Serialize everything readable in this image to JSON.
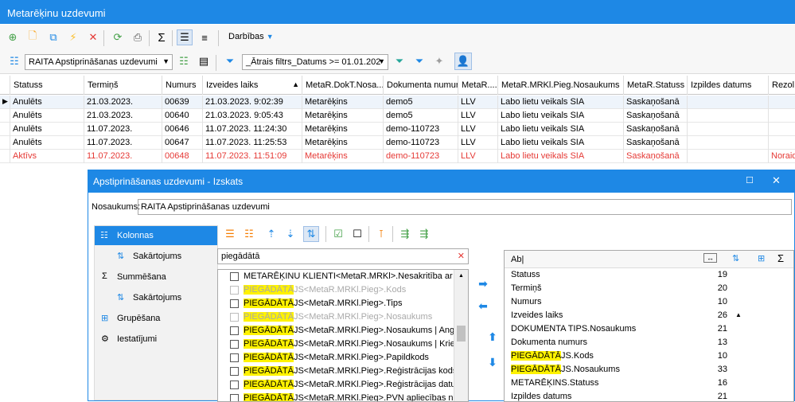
{
  "window": {
    "title": "Metarēķinu uzdevumi"
  },
  "toolbar": {
    "actions_label": "Darbības"
  },
  "views": {
    "selected": "RAITA Apstiprināšanas uzdevumi"
  },
  "filter": {
    "value": "_Ātrais filtrs_Datums >= 01.01.202"
  },
  "grid": {
    "columns": [
      "Statuss",
      "Termiņš",
      "Numurs",
      "Izveides laiks",
      "MetaR.DokT.Nosa...",
      "Dokumenta numurs",
      "MetaR....",
      "MetaR.MRKl.Pieg.Nosaukums",
      "MetaR.Statuss",
      "Izpildes datums",
      "Rezol..."
    ],
    "rows": [
      [
        "Anulēts",
        "21.03.2023.",
        "00639",
        "21.03.2023. 9:02:39",
        "Metarēķins",
        "demo5",
        "LLV",
        "Labo lietu veikals SIA",
        "Saskaņošanā",
        "",
        ""
      ],
      [
        "Anulēts",
        "21.03.2023.",
        "00640",
        "21.03.2023. 9:05:43",
        "Metarēķins",
        "demo5",
        "LLV",
        "Labo lietu veikals SIA",
        "Saskaņošanā",
        "",
        ""
      ],
      [
        "Anulēts",
        "11.07.2023.",
        "00646",
        "11.07.2023. 11:24:30",
        "Metarēķins",
        "demo-110723",
        "LLV",
        "Labo lietu veikals SIA",
        "Saskaņošanā",
        "",
        ""
      ],
      [
        "Anulēts",
        "11.07.2023.",
        "00647",
        "11.07.2023. 11:25:53",
        "Metarēķins",
        "demo-110723",
        "LLV",
        "Labo lietu veikals SIA",
        "Saskaņošanā",
        "",
        ""
      ],
      [
        "Aktīvs",
        "11.07.2023.",
        "00648",
        "11.07.2023. 11:51:09",
        "Metarēķins",
        "demo-110723",
        "LLV",
        "Labo lietu veikals SIA",
        "Saskaņošanā",
        "",
        "Noraid"
      ]
    ]
  },
  "dialog": {
    "title": "Apstiprināšanas uzdevumi - Izskats",
    "name_label": "Nosaukums:",
    "name_value": "RAITA Apstiprināšanas uzdevumi",
    "sidebar": [
      "Kolonnas",
      "Sakārtojums",
      "Summēšana",
      "Sakārtojums",
      "Grupēšana",
      "Iestatījumi"
    ],
    "search_value": "piegādātā",
    "available": [
      {
        "pre": "METARĒĶINU KLIENTI<MetaR.MRKl>.Nesakritība ar ",
        "hl": "piegā",
        "post": "",
        "disabled": false
      },
      {
        "pre": "",
        "hl": "PIEGĀDĀTĀ",
        "post": "JS<MetaR.MRKl.Pieg>.Kods",
        "disabled": true
      },
      {
        "pre": "",
        "hl": "PIEGĀDĀTĀ",
        "post": "JS<MetaR.MRKl.Pieg>.Tips",
        "disabled": false
      },
      {
        "pre": "",
        "hl": "PIEGĀDĀTĀ",
        "post": "JS<MetaR.MRKl.Pieg>.Nosaukums",
        "disabled": true
      },
      {
        "pre": "",
        "hl": "PIEGĀDĀTĀ",
        "post": "JS<MetaR.MRKl.Pieg>.Nosaukums | Angļu",
        "disabled": false
      },
      {
        "pre": "",
        "hl": "PIEGĀDĀTĀ",
        "post": "JS<MetaR.MRKl.Pieg>.Nosaukums | Krievu",
        "disabled": false
      },
      {
        "pre": "",
        "hl": "PIEGĀDĀTĀ",
        "post": "JS<MetaR.MRKl.Pieg>.Papildkods",
        "disabled": false
      },
      {
        "pre": "",
        "hl": "PIEGĀDĀTĀ",
        "post": "JS<MetaR.MRKl.Pieg>.Reģistrācijas kods",
        "disabled": false
      },
      {
        "pre": "",
        "hl": "PIEGĀDĀTĀ",
        "post": "JS<MetaR.MRKl.Pieg>.Reģistrācijas datums",
        "disabled": false
      },
      {
        "pre": "",
        "hl": "PIEGĀDĀTĀ",
        "post": "JS<MetaR.MRKl.Pieg>.PVN apliecības numurs",
        "disabled": false
      }
    ],
    "selected_header": "Ab|",
    "selected": [
      {
        "pre": "Statuss",
        "hl": "",
        "post": "",
        "width": "19",
        "sort": ""
      },
      {
        "pre": "Termiņš",
        "hl": "",
        "post": "",
        "width": "20",
        "sort": ""
      },
      {
        "pre": "Numurs",
        "hl": "",
        "post": "",
        "width": "10",
        "sort": ""
      },
      {
        "pre": "Izveides laiks",
        "hl": "",
        "post": "",
        "width": "26",
        "sort": "▲"
      },
      {
        "pre": "DOKUMENTA TIPS.Nosaukums",
        "hl": "",
        "post": "",
        "width": "21",
        "sort": ""
      },
      {
        "pre": "Dokumenta numurs",
        "hl": "",
        "post": "",
        "width": "13",
        "sort": ""
      },
      {
        "pre": "",
        "hl": "PIEGĀDĀTĀ",
        "post": "JS.Kods",
        "width": "10",
        "sort": ""
      },
      {
        "pre": "",
        "hl": "PIEGĀDĀTĀ",
        "post": "JS.Nosaukums",
        "width": "33",
        "sort": ""
      },
      {
        "pre": "METARĒĶINS.Statuss",
        "hl": "",
        "post": "",
        "width": "16",
        "sort": ""
      },
      {
        "pre": "Izpildes datums",
        "hl": "",
        "post": "",
        "width": "21",
        "sort": ""
      }
    ]
  },
  "colors": {
    "accent": "#1e88e5",
    "highlight": "#fff200",
    "active_row": "#e53935"
  }
}
